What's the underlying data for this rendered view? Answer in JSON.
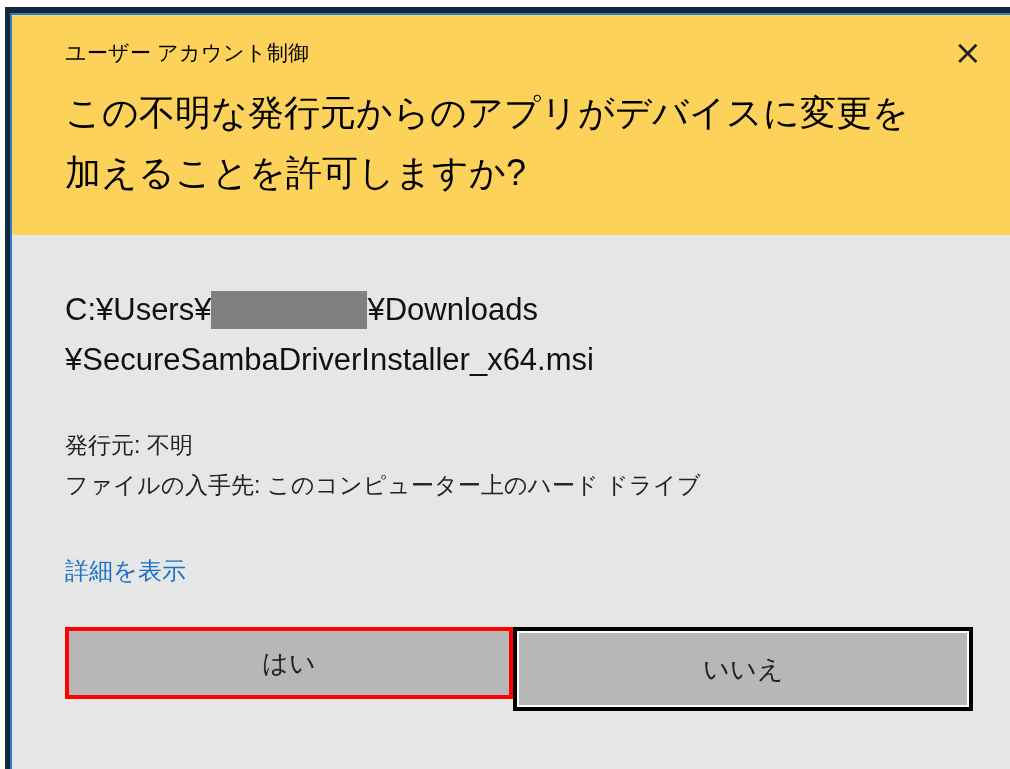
{
  "window": {
    "title": "ユーザー アカウント制御",
    "close": "×"
  },
  "question": "この不明な発行元からのアプリがデバイスに変更を加えることを許可しますか?",
  "path": {
    "line_1": {
      "before": "C:¥Users¥",
      "redacted": true,
      "after": "¥Downloads"
    },
    "line_2": "¥SecureSambaDriverInstaller_x64.msi"
  },
  "details": [
    "発行元: 不明",
    "ファイルの入手先: このコンピューター上のハード ドライブ"
  ],
  "link": "詳細を表示",
  "buttons": [
    {
      "label": "はい",
      "highlighted": true,
      "focused": false
    },
    {
      "label": "いいえ",
      "highlighted": false,
      "focused": true
    }
  ]
}
